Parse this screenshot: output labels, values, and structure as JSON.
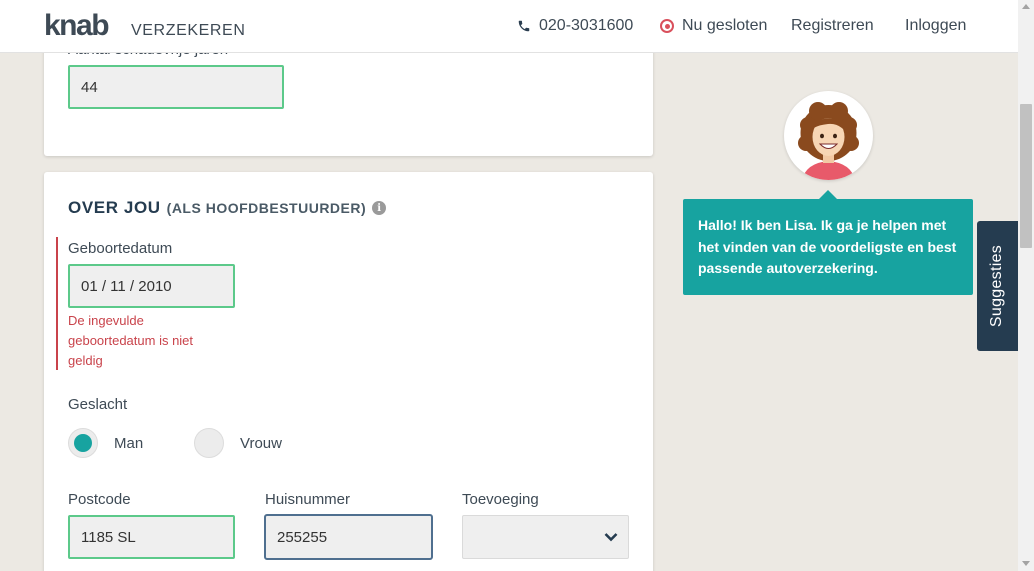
{
  "header": {
    "logo": "knab",
    "logo_sub": "VERZEKEREN",
    "phone": "020-3031600",
    "status": "Nu gesloten",
    "register": "Registreren",
    "login": "Inloggen",
    "icons": {
      "phone": "phone-icon",
      "status": "closed-status-icon"
    },
    "colors": {
      "brand": "#3e4a55",
      "status": "#d9505c"
    }
  },
  "previous_field": {
    "label_partial": "Aantal schadevrije jaren",
    "value": "44"
  },
  "section": {
    "title": "OVER JOU",
    "subtitle": "(ALS HOOFDBESTUURDER)",
    "info_icon": "info-icon"
  },
  "birthdate": {
    "label": "Geboortedatum",
    "value": "01 / 11 / 2010",
    "error": "De ingevulde geboortedatum is niet geldig"
  },
  "gender": {
    "label": "Geslacht",
    "options": [
      "Man",
      "Vrouw"
    ],
    "selected": "Man"
  },
  "address": {
    "postcode_label": "Postcode",
    "postcode_value": "1185 SL",
    "housenumber_label": "Huisnummer",
    "housenumber_value": "255255",
    "addition_label": "Toevoeging",
    "addition_value": ""
  },
  "assistant": {
    "message": "Hallo! Ik ben Lisa. Ik ga je helpen met het vinden van de voordeligste en best passende autoverzekering.",
    "color": "#17a3a0"
  },
  "suggestions_tab": "Suggesties",
  "colors": {
    "valid_border": "#5cc98a",
    "error": "#c9434b",
    "accent": "#17a3a0",
    "navy": "#253c50"
  }
}
